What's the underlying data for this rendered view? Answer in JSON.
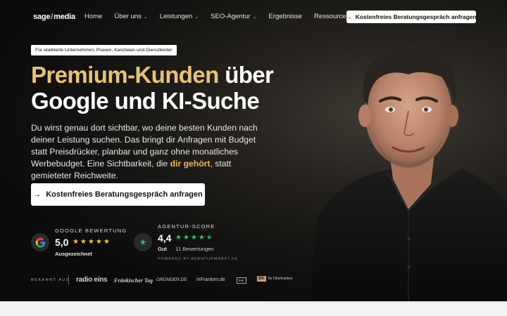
{
  "brand": {
    "logo_left": "sage",
    "logo_slash": "/",
    "logo_right": "media",
    "accent_color": "#e8c07a"
  },
  "nav": {
    "items": [
      {
        "label": "Home",
        "dropdown": false
      },
      {
        "label": "Über uns",
        "dropdown": true
      },
      {
        "label": "Leistungen",
        "dropdown": true
      },
      {
        "label": "SEO-Agentur",
        "dropdown": true
      },
      {
        "label": "Ergebnisse",
        "dropdown": false
      },
      {
        "label": "Ressourcen",
        "dropdown": true
      }
    ],
    "cta_label": "Kostenfreies Beratungsgespräch anfragen"
  },
  "hero": {
    "tagline": "Für etablierte Unternehmen, Praxen, Kanzleien und Dienstleister",
    "headline_gold": "Premium-Kunden",
    "headline_white_1": " über",
    "headline_white_2": "Google und KI-Suche",
    "lead_1": "Du wirst genau dort sichtbar, wo deine besten Kunden nach deiner Leistung suchen. Das bringt dir Anfragen mit Budget statt Preisdrücker, planbar und ganz ohne monatliches Werbebudget. Eine Sichtbarkeit, die ",
    "lead_highlight": "dir gehört",
    "lead_2": ", statt gemieteter Reichweite.",
    "cta_label": "Kostenfreies Beratungsgespräch anfragen"
  },
  "reviews": {
    "google": {
      "title": "GOOGLE BEWERTUNG",
      "score": "5,0",
      "rating": 5,
      "subtitle": "Ausgezeichnet",
      "star_color": "#f5c04a"
    },
    "agentur": {
      "title": "AGENTUR-SCORE",
      "score": "4,4",
      "rating": 4.4,
      "rating_label": "Gut",
      "count": "11 Bewertungen",
      "powered_by": "POWERED BY AGENTURMARKT.DE",
      "star_color": "#3dbd73"
    }
  },
  "press": {
    "label": "BEKANNT AUS",
    "logos": [
      "radio eins",
      "Fränkischer Tag",
      "GRÜNDER.DE",
      "inFranken.de",
      "IHK",
      "BK",
      "für Oberfranken"
    ]
  },
  "icons": {
    "arrow": "arrow-right-icon",
    "chevron": "chevron-down-icon",
    "google": "google-g-icon",
    "agentur": "star-badge-icon"
  }
}
